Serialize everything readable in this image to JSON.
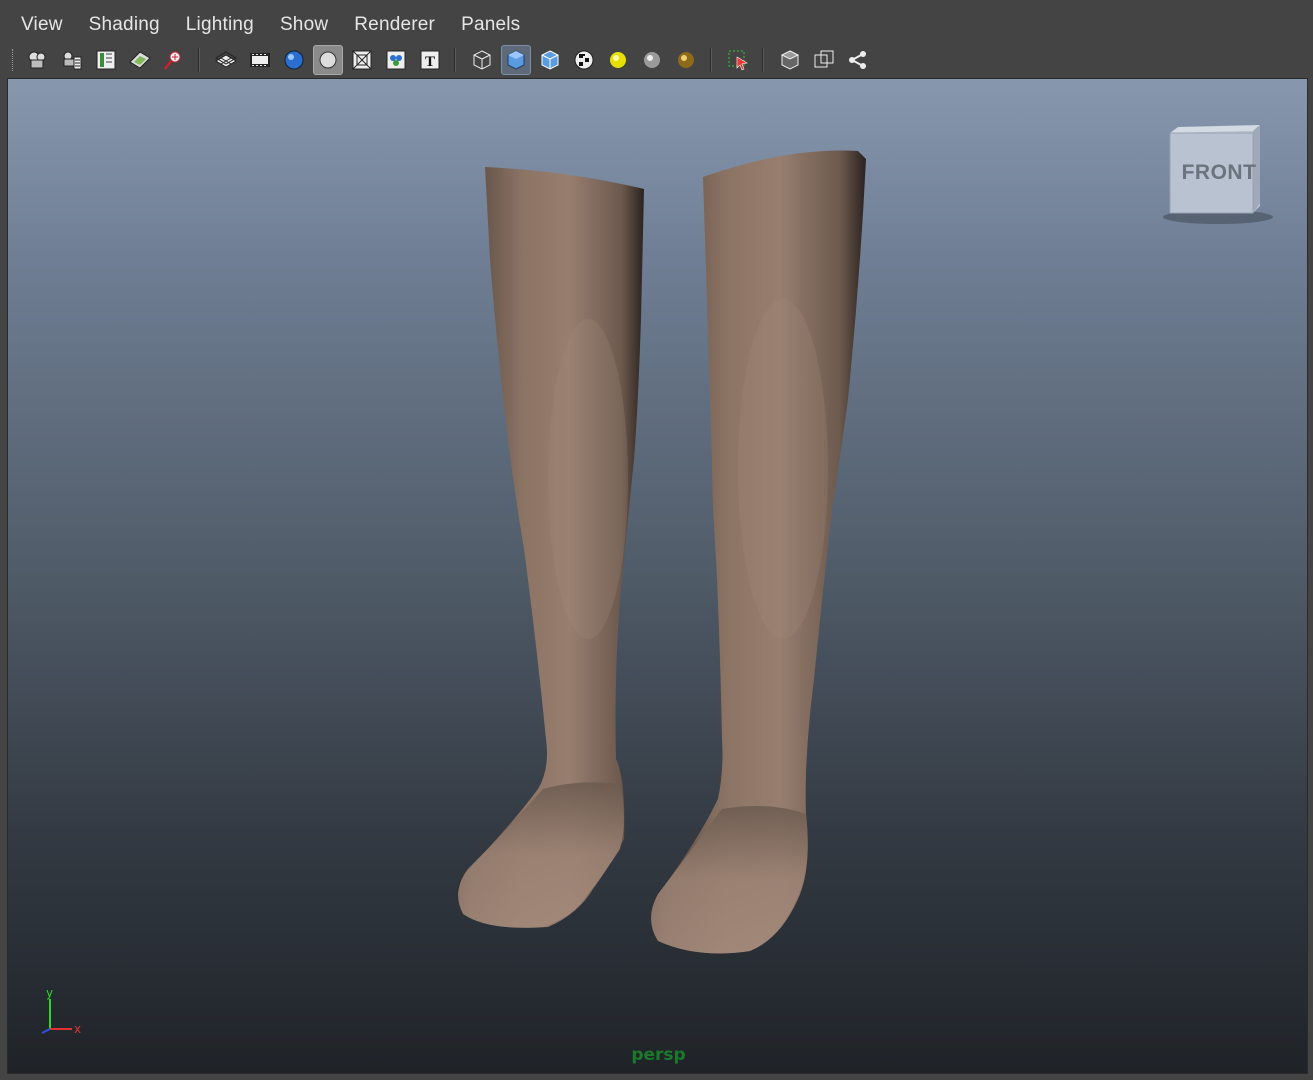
{
  "menubar": {
    "items": [
      {
        "label": "View"
      },
      {
        "label": "Shading"
      },
      {
        "label": "Lighting"
      },
      {
        "label": "Show"
      },
      {
        "label": "Renderer"
      },
      {
        "label": "Panels"
      }
    ]
  },
  "toolbar": {
    "groups": [
      [
        "select-camera-icon",
        "camera-attributes-icon",
        "bookmarks-icon",
        "image-plane-icon",
        "2d-pan-zoom-icon"
      ],
      [
        "grid-icon",
        "film-gate-icon",
        "resolution-gate-icon",
        "gate-mask-icon",
        "field-chart-icon",
        "safe-action-icon",
        "safe-title-icon"
      ],
      [
        "wireframe-icon",
        "smooth-shade-all-icon",
        "wireframe-on-shaded-icon",
        "textured-icon",
        "use-all-lights-icon",
        "shadows-icon",
        "ambient-occlusion-icon"
      ],
      [
        "isolate-select-icon"
      ],
      [
        "xray-icon",
        "xray-joints-icon",
        "xray-components-icon"
      ]
    ],
    "active": "smooth-shade-all-icon",
    "pressed": "gate-mask-icon"
  },
  "viewport": {
    "camera_name": "persp",
    "viewcube_face": "FRONT",
    "axis_labels": {
      "y": "y",
      "x": "x"
    }
  },
  "colors": {
    "skin": "#9a8273",
    "viewport_top": "#8797ad",
    "viewport_bottom": "#1f2328",
    "camera_label": "#1a7a2a"
  }
}
